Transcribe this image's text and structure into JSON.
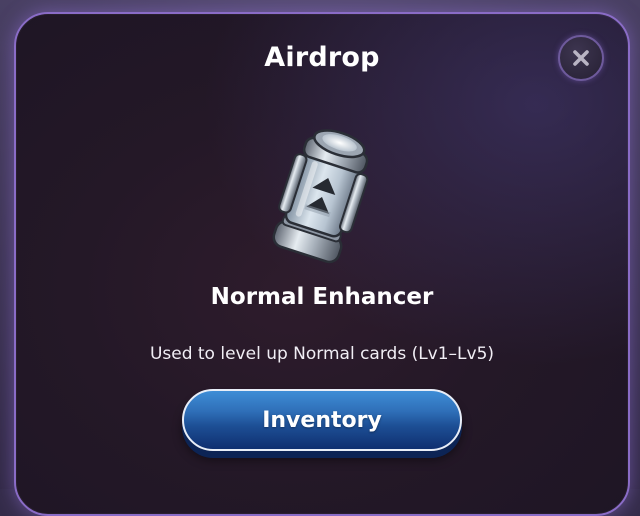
{
  "dialog": {
    "title": "Airdrop",
    "item": {
      "name": "Normal Enhancer",
      "description": "Used to level up Normal cards (Lv1–Lv5)",
      "icon": "enhancer-canister-icon"
    },
    "primary_button_label": "Inventory",
    "close_icon": "close-icon"
  },
  "colors": {
    "accent_border": "#8a6cc7",
    "button_top": "#3e8dd6",
    "button_bottom": "#0f2f70",
    "panel_bg": "#241827"
  }
}
